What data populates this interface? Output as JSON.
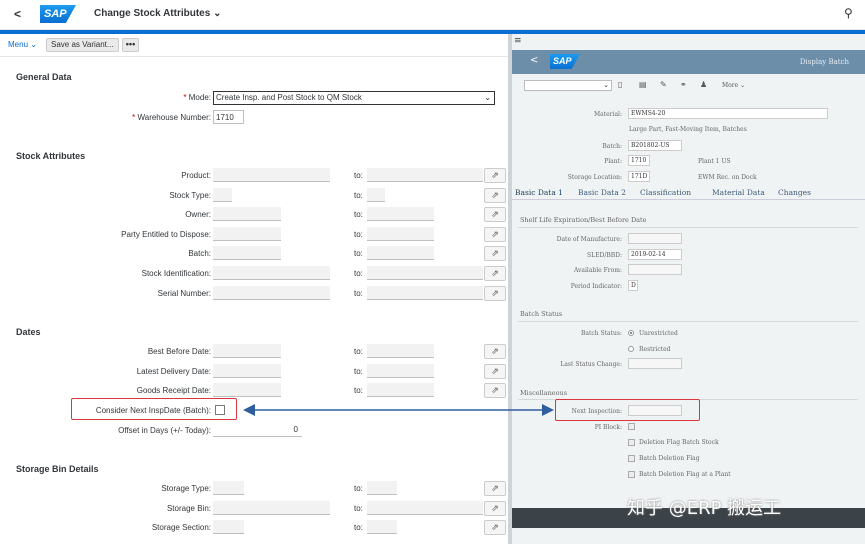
{
  "shell": {
    "title": "Change Stock Attributes",
    "logo": "SAP",
    "back_icon": "chevron-left-icon",
    "search_icon": "search-icon"
  },
  "toolbar": {
    "menu": "Menu",
    "save_variant": "Save as Variant...",
    "more": "•••"
  },
  "general": {
    "title": "General Data",
    "mode_label": "Mode:",
    "mode_value": "Create Insp. and Post Stock to QM Stock",
    "warehouse_label": "Warehouse Number:",
    "warehouse_value": "1710"
  },
  "stock": {
    "title": "Stock Attributes",
    "to": "to:",
    "rows": [
      {
        "label": "Product:"
      },
      {
        "label": "Stock Type:"
      },
      {
        "label": "Owner:"
      },
      {
        "label": "Party Entitled to Dispose:"
      },
      {
        "label": "Batch:"
      },
      {
        "label": "Stock Identification:"
      },
      {
        "label": "Serial Number:"
      }
    ]
  },
  "dates": {
    "title": "Dates",
    "rows": [
      {
        "label": "Best Before Date:"
      },
      {
        "label": "Latest Delivery Date:"
      },
      {
        "label": "Goods Receipt Date:"
      }
    ],
    "consider_label": "Consider Next InspDate (Batch):",
    "offset_label": "Offset in Days (+/- Today):",
    "offset_value": "0"
  },
  "bin": {
    "title": "Storage Bin Details",
    "rows": [
      {
        "label": "Storage Type:"
      },
      {
        "label": "Storage Bin:"
      },
      {
        "label": "Storage Section:"
      }
    ]
  },
  "right": {
    "menu_icon": "≡",
    "logo": "SAP",
    "title": "Display Batch",
    "more": "More",
    "material_label": "Material:",
    "material_value": "EWMS4-20",
    "material_desc": "Large Part, Fast-Moving Item, Batches",
    "batch_label": "Batch:",
    "batch_value": "B201802-US",
    "plant_label": "Plant:",
    "plant_value": "1710",
    "plant_desc": "Plant 1 US",
    "sloc_label": "Storage Location:",
    "sloc_value": "171D",
    "sloc_desc": "EWM Rec. on Dock",
    "tabs": [
      "Basic Data 1",
      "Basic Data 2",
      "Classification",
      "Material Data",
      "Changes"
    ],
    "shelf_title": "Shelf Life Expiration/Best Before Date",
    "dom_label": "Date of Manufacture:",
    "sled_label": "SLED/BBD:",
    "sled_value": "2019-02-14",
    "avail_label": "Available From:",
    "period_label": "Period Indicator:",
    "period_value": "D",
    "status_title": "Batch Status",
    "bstatus_label": "Batch Status:",
    "unrestricted": "Unrestricted",
    "restricted": "Restricted",
    "last_change_label": "Last Status Change:",
    "misc_title": "Miscellaneous",
    "next_insp_label": "Next Inspection:",
    "pi_block_label": "PI Block:",
    "flags": [
      "Deletion Flag Batch Stock",
      "Batch Deletion Flag",
      "Batch Deletion Flag at a Plant"
    ]
  },
  "watermark": "知乎 @ERP 搬运工"
}
